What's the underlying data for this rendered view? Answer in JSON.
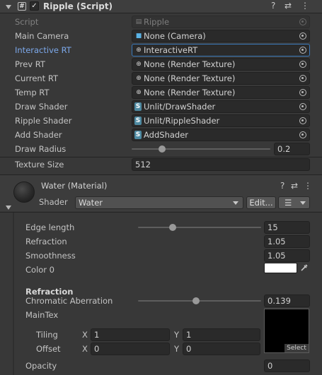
{
  "component": {
    "title": "Ripple (Script)",
    "enabled_mark": "✓",
    "hash_icon": "#",
    "help_icon": "?",
    "preset_icon": "⇄",
    "menu_icon": "⋮"
  },
  "fields": [
    {
      "label": "Script",
      "value": "Ripple",
      "icon": "script-icon",
      "glyph": "▤"
    },
    {
      "label": "Main Camera",
      "value": "None (Camera)",
      "icon": "camera-icon",
      "glyph": "■"
    },
    {
      "label": "Interactive RT",
      "value": "InteractiveRT",
      "icon": "render-texture-icon",
      "glyph": "⊕"
    },
    {
      "label": "Prev RT",
      "value": "None (Render Texture)",
      "icon": "render-texture-icon",
      "glyph": "⊕"
    },
    {
      "label": "Current RT",
      "value": "None (Render Texture)",
      "icon": "render-texture-icon",
      "glyph": "⊕"
    },
    {
      "label": "Temp RT",
      "value": "None (Render Texture)",
      "icon": "render-texture-icon",
      "glyph": "⊕"
    },
    {
      "label": "Draw Shader",
      "value": "Unlit/DrawShader",
      "icon": "shader-icon",
      "glyph": "S"
    },
    {
      "label": "Ripple Shader",
      "value": "Unlit/RippleShader",
      "icon": "shader-icon",
      "glyph": "S"
    },
    {
      "label": "Add Shader",
      "value": "AddShader",
      "icon": "shader-icon",
      "glyph": "S"
    }
  ],
  "draw_radius": {
    "label": "Draw Radius",
    "value": "0.2",
    "fraction": 0.22
  },
  "texture_size": {
    "label": "Texture Size",
    "value": "512"
  },
  "material": {
    "title": "Water (Material)",
    "shader_label": "Shader",
    "shader_value": "Water",
    "edit_button": "Edit...",
    "list_icon": "☰",
    "properties": {
      "edge_length": {
        "label": "Edge length",
        "value": "15",
        "fraction": 0.28
      },
      "refraction": {
        "label": "Refraction",
        "value": "1.05"
      },
      "smoothness": {
        "label": "Smoothness",
        "value": "1.05"
      },
      "color0": {
        "label": "Color 0",
        "color": "#ffffff"
      },
      "refraction_header": "Refraction",
      "chromatic_aberration": {
        "label": "Chromatic Aberration",
        "value": "0.139",
        "fraction": 0.47
      },
      "main_tex": {
        "label": "MainTex",
        "select_label": "Select"
      },
      "tiling": {
        "label": "Tiling",
        "x_label": "X",
        "x": "1",
        "y_label": "Y",
        "y": "1"
      },
      "offset": {
        "label": "Offset",
        "x_label": "X",
        "x": "0",
        "y_label": "Y",
        "y": "0"
      },
      "opacity": {
        "label": "Opacity",
        "value": "0"
      }
    }
  },
  "colors": {
    "panel": "#383838",
    "field": "#2a2a2a",
    "focus": "#3a79bb",
    "active_label": "#7ca8ea",
    "shader_icon": "#4e8aa2",
    "camera_icon": "#5ab3e6"
  }
}
